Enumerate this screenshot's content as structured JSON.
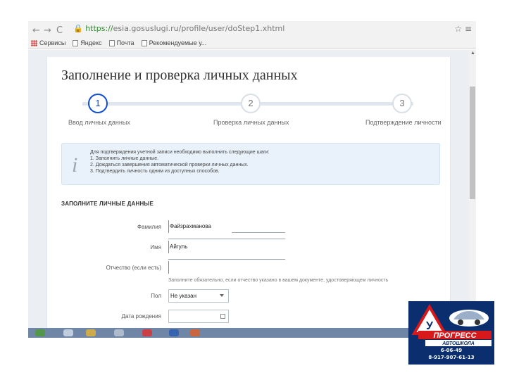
{
  "browser": {
    "back": "←",
    "forward": "→",
    "reload": "C",
    "url_https": "https://",
    "url_rest": "esia.gosuslugi.ru/profile/user/doStep1.xhtml",
    "bookmarks": [
      "Сервисы",
      "Яндекс",
      "Почта",
      "Рекомендуемые у..."
    ],
    "menu_glyph": "≡",
    "star_glyph": "☆"
  },
  "page": {
    "title": "Заполнение и проверка личных данных",
    "steps": [
      {
        "number": "1",
        "label": "Ввод личных данных"
      },
      {
        "number": "2",
        "label": "Проверка личных данных"
      },
      {
        "number": "3",
        "label": "Подтверждение личности"
      }
    ],
    "info": {
      "icon": "i",
      "intro": "Для подтверждения учетной записи необходимо выполнить следующие шаги:",
      "items": [
        "1. Заполнить личные данные.",
        "2. Дождаться завершения автоматической проверки личных данных.",
        "3. Подтвердить личность одним из доступных способов."
      ]
    },
    "section_title": "ЗАПОЛНИТЕ ЛИЧНЫЕ ДАННЫЕ",
    "form": {
      "last_name_label": "Фамилия",
      "last_name_value": "Файзрахманова",
      "first_name_label": "Имя",
      "first_name_value": "Айгуль",
      "patronymic_label": "Отчество (если есть)",
      "patronymic_value": "",
      "patronymic_hint": "Заполните обязательно, если отчество указано в вашем документе, удостоверяющем личность",
      "gender_label": "Пол",
      "gender_value": "Не указан",
      "dob_label": "Дата рождения",
      "dob_value": ""
    }
  },
  "logo": {
    "letter": "У",
    "name": "ПРОГРЕСС",
    "subtitle": "АВТОШКОЛА",
    "phone1": "6-06-49",
    "phone2": "8-917-907-61-13",
    "colors": {
      "background": "#0b2f6e",
      "red": "#d7191c",
      "white": "#ffffff"
    }
  }
}
